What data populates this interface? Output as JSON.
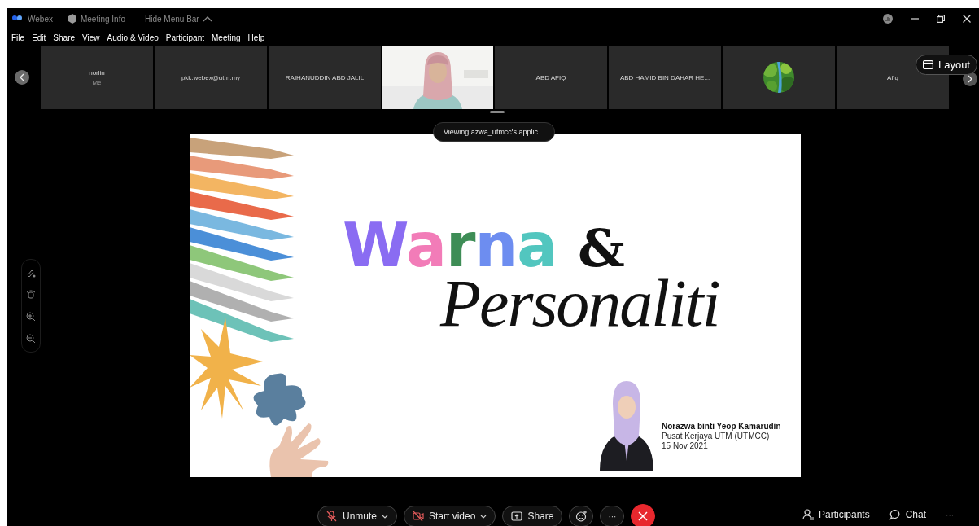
{
  "window": {
    "app_name": "Webex",
    "meeting_info": "Meeting Info",
    "hide_menu": "Hide Menu Bar"
  },
  "menu": [
    "File",
    "Edit",
    "Share",
    "View",
    "Audio & Video",
    "Participant",
    "Meeting",
    "Help"
  ],
  "participants": [
    {
      "kind": "name",
      "name": "norlin",
      "subtitle": "Me"
    },
    {
      "kind": "name",
      "name": "pkk.webex@utm.my"
    },
    {
      "kind": "name",
      "name": "RAIHANUDDIN ABD JALIL"
    },
    {
      "kind": "video"
    },
    {
      "kind": "name",
      "name": "ABD AFIQ"
    },
    {
      "kind": "name",
      "name": "ABD HAMID BIN DAHAR HE..."
    },
    {
      "kind": "avatar"
    },
    {
      "kind": "name",
      "name": "Afiq"
    }
  ],
  "layout_button": "Layout",
  "share_banner": "Viewing azwa_utmcc's applic...",
  "slide": {
    "title": "Warna",
    "ampersand": "&",
    "subtitle": "Personaliti",
    "presenter_name": "Norazwa binti Yeop Kamarudin",
    "presenter_org": "Pusat Kerjaya UTM (UTMCC)",
    "date": "15 Nov 2021"
  },
  "controls": [
    {
      "kind": "mute",
      "label": "Unmute",
      "dropdown": true
    },
    {
      "kind": "video",
      "label": "Start video",
      "dropdown": true
    },
    {
      "kind": "share",
      "label": "Share",
      "dropdown": false
    },
    {
      "kind": "reaction"
    },
    {
      "kind": "more",
      "label": "···"
    },
    {
      "kind": "end"
    }
  ],
  "side_controls": [
    {
      "kind": "participants",
      "label": "Participants"
    },
    {
      "kind": "chat",
      "label": "Chat"
    },
    {
      "kind": "more",
      "label": "···"
    }
  ]
}
